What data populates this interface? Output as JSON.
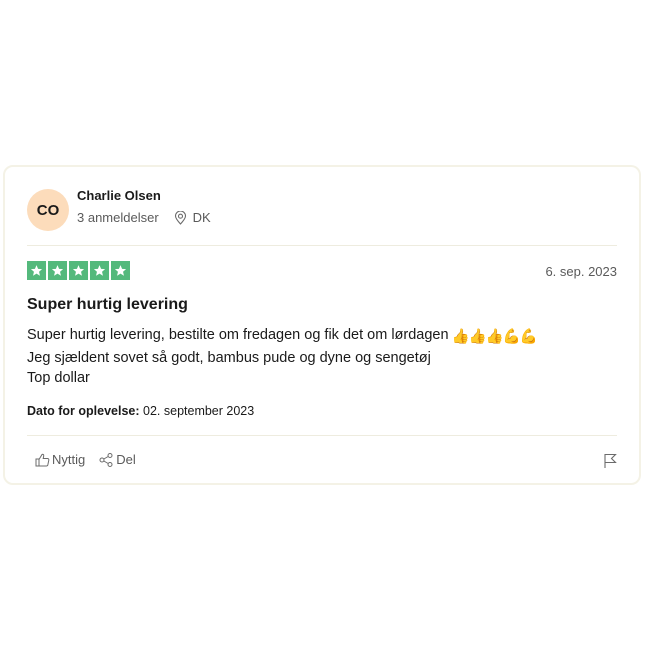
{
  "review": {
    "consumer": {
      "initials": "CO",
      "name": "Charlie Olsen",
      "review_count": "3 anmeldelser",
      "location_icon": "location-pin-icon",
      "country": "DK",
      "avatar_color": "#fcdcbb"
    },
    "rating": {
      "stars": 5,
      "max_stars": 5,
      "star_color": "#54b97c",
      "star_icon": "star-icon"
    },
    "published_date": "6. sep. 2023",
    "title": "Super hurtig levering",
    "body_lines": [
      "Super hurtig levering, bestilte om fredagen og fik det om lørdagen",
      "Jeg sjældent sovet så godt, bambus pude og dyne og sengetøj",
      "Top dollar"
    ],
    "body_emojis": "👍👍👍💪💪",
    "experience_label": "Dato for oplevelse:",
    "experience_date": "02. september 2023",
    "actions": {
      "useful_label": "Nyttig",
      "useful_icon": "thumbs-up-icon",
      "share_label": "Del",
      "share_icon": "share-icon",
      "report_icon": "flag-icon"
    }
  }
}
